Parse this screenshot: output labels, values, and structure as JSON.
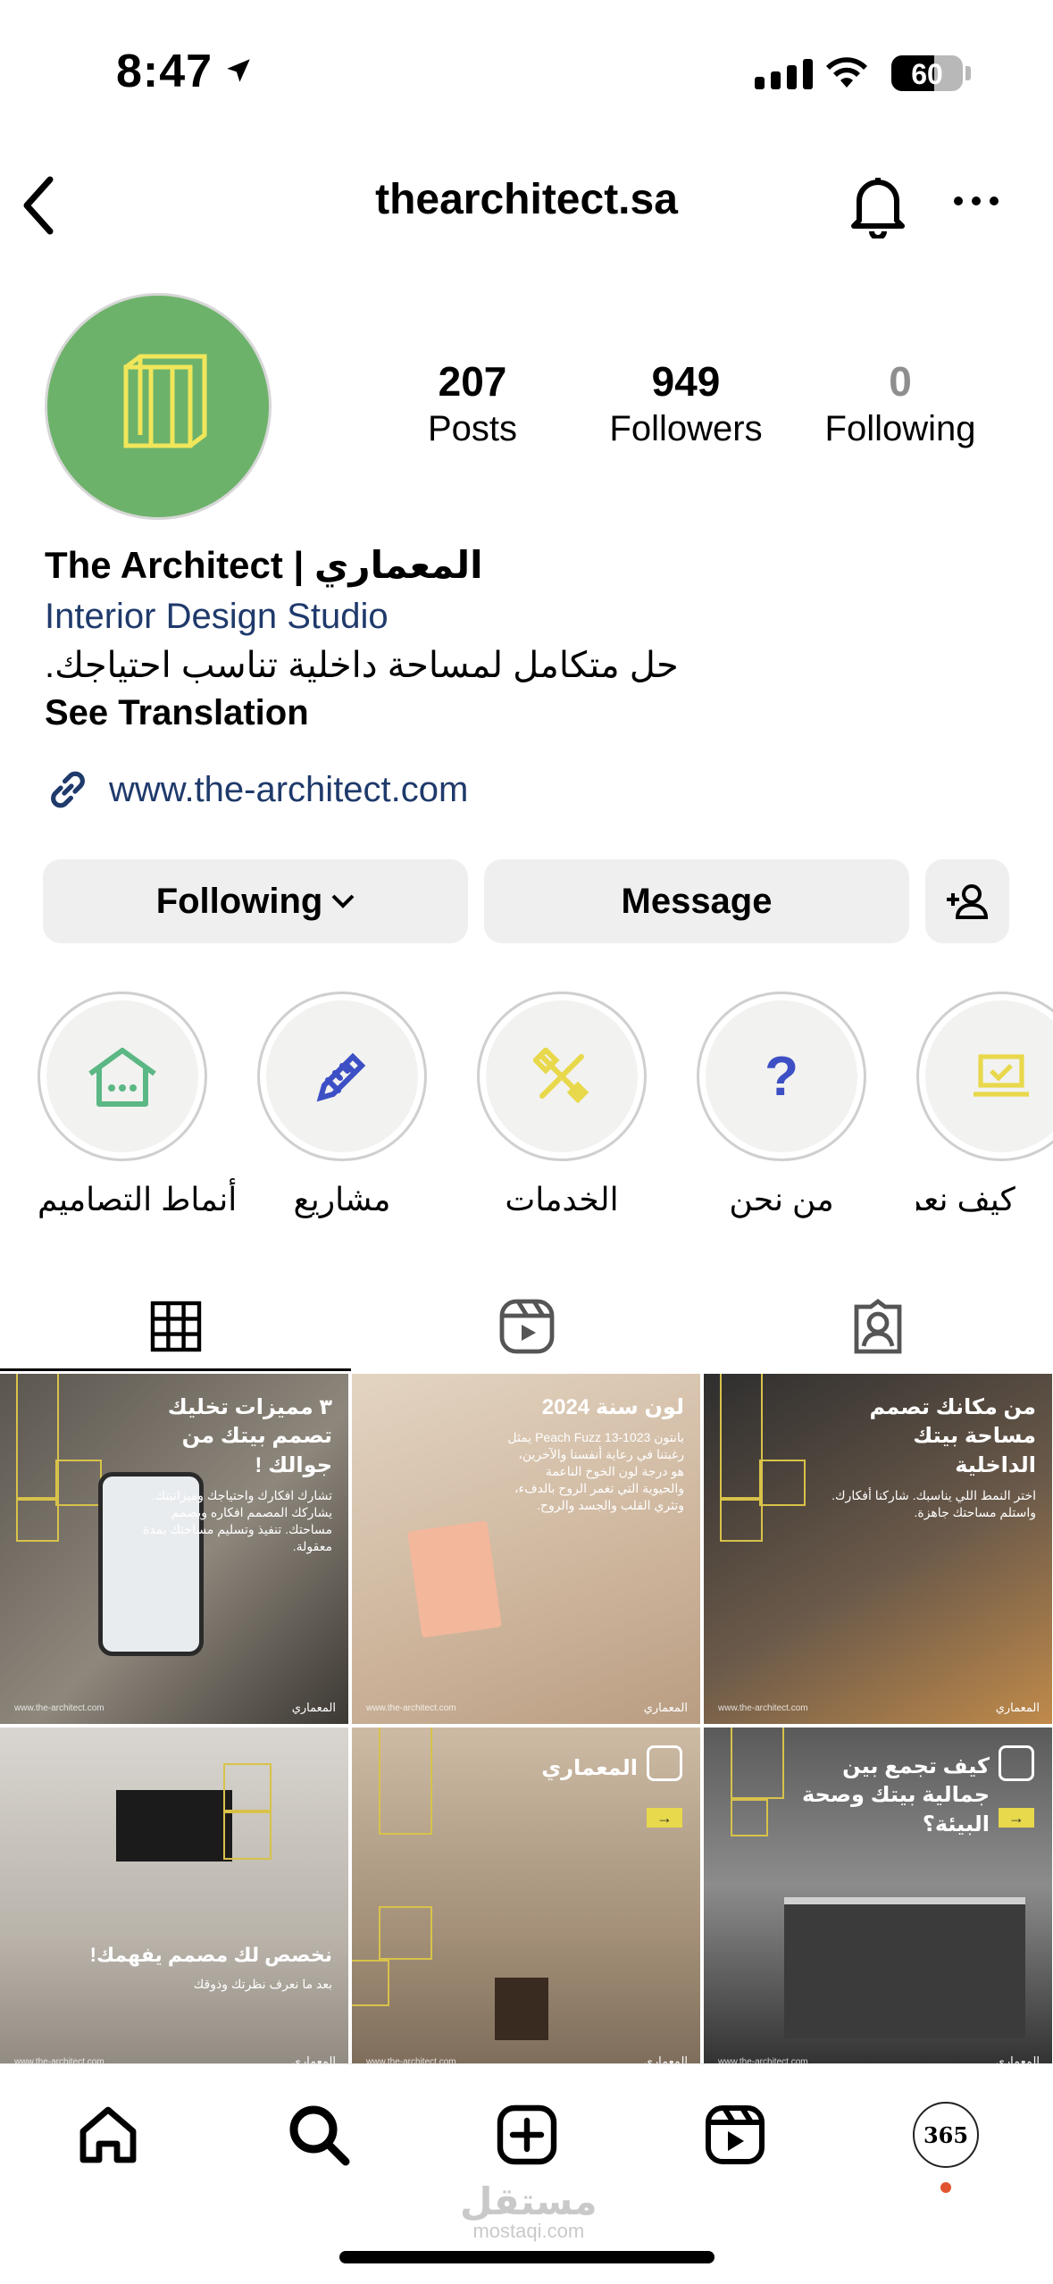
{
  "status_bar": {
    "time": "8:47",
    "battery": "60",
    "battery_level": 0.6
  },
  "header": {
    "username": "thearchitect.sa"
  },
  "profile": {
    "stats": [
      {
        "value": "207",
        "label": "Posts"
      },
      {
        "value": "949",
        "label": "Followers"
      },
      {
        "value": "0",
        "label": "Following"
      }
    ],
    "name": "The Architect | المعماري",
    "category": "Interior Design Studio",
    "bio": "حل متكامل لمساحة داخلية تناسب احتياجك.",
    "see_translation": "See Translation",
    "link": "www.the-architect.com",
    "avatar_color": "#6db26a"
  },
  "actions": {
    "following": "Following",
    "message": "Message"
  },
  "highlights": [
    {
      "label": "أنماط التصاميم",
      "icon": "house-icon"
    },
    {
      "label": "مشاريع",
      "icon": "pencil-ruler-icon"
    },
    {
      "label": "الخدمات",
      "icon": "tools-icon"
    },
    {
      "label": "من نحن",
      "icon": "question-icon"
    },
    {
      "label": "كيف نعمل",
      "icon": "laptop-icon"
    }
  ],
  "tabs": [
    "grid",
    "reels",
    "tagged"
  ],
  "posts": [
    {
      "title": "٣ مميزات تخليك تصمم بيتك من جوالك !",
      "text": "تشارك افكارك واحتياجك وميزانيتك. يشاركك المصمم افكاره ويصمم مساحتك. تنفيذ وتسليم مساحتك بمدة معقولة.",
      "brand": "المعماري",
      "url": "www.the-architect.com"
    },
    {
      "title": "لون سنة 2024",
      "text": "بانتون Peach Fuzz 13-1023 يمثل رغبتنا في رعاية أنفسنا والآخرين، هو درجة لون الخوخ الناعمة والحيوية التي تغمر الروح بالدفء، وتثري القلب والجسد والروح.",
      "brand": "المعماري",
      "url": "www.the-architect.com"
    },
    {
      "title": "من مكانك تصمم مساحة بيتك الداخلية",
      "text": "اختر النمط اللي يناسبك. شاركنا أفكارك. واستلم مساحتك جاهزة.",
      "brand": "المعماري",
      "url": "www.the-architect.com"
    },
    {
      "title": "نخصص لك مصمم يفهمك!",
      "text": "بعد ما نعرف نظرتك وذوقك",
      "brand": "المعماري",
      "url": "www.the-architect.com"
    },
    {
      "title": "المعماري",
      "text": "",
      "brand": "المعماري",
      "url": "www.the-architect.com"
    },
    {
      "title": "كيف تجمع بين جمالية بيتك وصحة البيئة؟",
      "text": "",
      "brand": "المعماري",
      "url": "www.the-architect.com"
    }
  ],
  "bottom_nav": [
    "home-icon",
    "search-icon",
    "create-icon",
    "reels-icon",
    "profile-icon"
  ],
  "watermark": {
    "text": "مستقل",
    "sub": "mostaqi.com"
  },
  "colors": {
    "link": "#1f3a6b",
    "button_bg": "#efefef",
    "accent_gold": "#d8c24a"
  }
}
